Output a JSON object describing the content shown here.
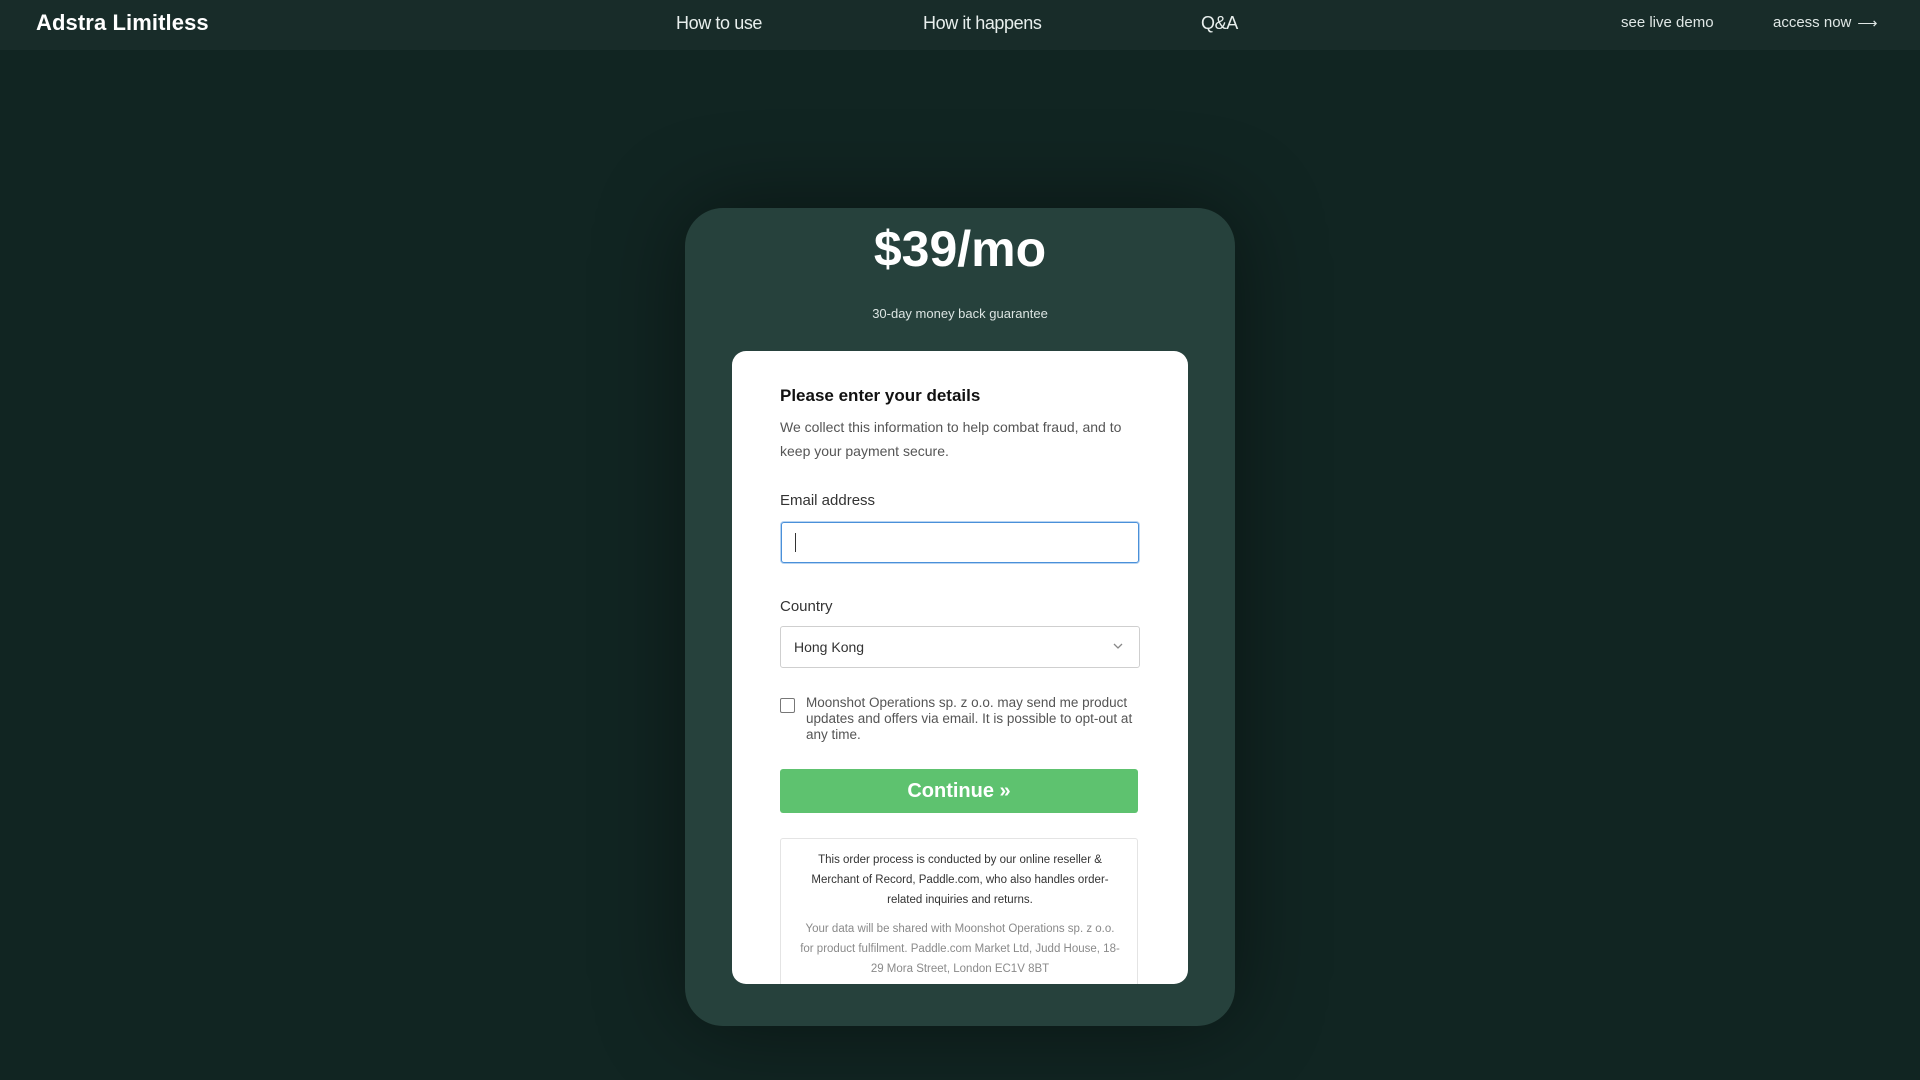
{
  "header": {
    "brand": "Adstra Limitless",
    "nav": [
      "How to use",
      "How it happens",
      "Q&A"
    ],
    "demo_label": "see live demo",
    "access_label": "access now",
    "access_icon": "arrow-right-icon"
  },
  "pricing": {
    "price": "$39/mo",
    "guarantee": "30-day money back guarantee"
  },
  "form": {
    "title": "Please enter your details",
    "description": "We collect this information to help combat fraud, and to keep your payment secure.",
    "email_label": "Email address",
    "email_value": "",
    "country_label": "Country",
    "country_value": "Hong Kong",
    "consent_text": "Moonshot Operations sp. z o.o. may send me product updates and offers via email. It is possible to opt-out at any time.",
    "consent_checked": false,
    "continue_label": "Continue »",
    "notice_main": "This order process is conducted by our online reseller & Merchant of Record, Paddle.com, who also handles order-related inquiries and returns.",
    "notice_secondary": "Your data will be shared with Moonshot Operations sp. z o.o. for product fulfilment. Paddle.com Market Ltd, Judd House, 18-29 Mora Street, London EC1V 8BT"
  },
  "colors": {
    "background": "#112522",
    "panel": "#26413c",
    "accent_button": "#5ec26f",
    "focus_border": "#4a90d9"
  }
}
